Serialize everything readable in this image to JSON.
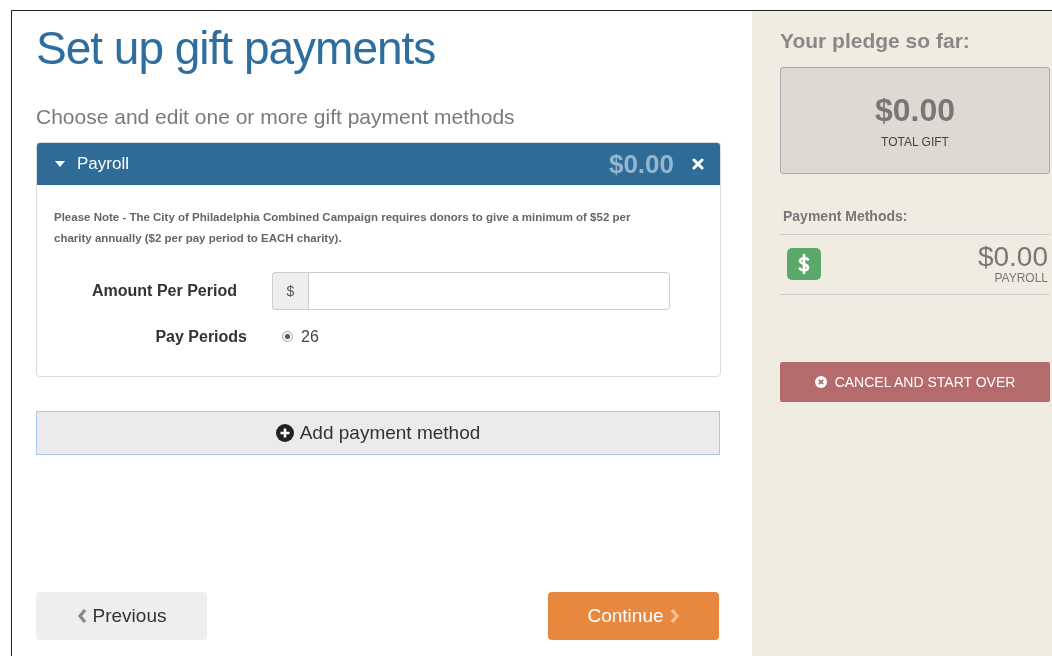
{
  "page": {
    "title": "Set up gift payments",
    "subtitle": "Choose and edit one or more gift payment methods"
  },
  "methods": [
    {
      "name": "Payroll",
      "amount": "$0.00",
      "expanded": true,
      "note": "Please Note - The City of Philadelphia Combined Campaign requires donors to give a minimum of $52 per charity annually ($2 per pay period to EACH charity).",
      "amount_label": "Amount Per Period",
      "amount_prefix": "$",
      "periods_label": "Pay Periods",
      "period_options": [
        {
          "label": "26",
          "selected": true
        }
      ]
    }
  ],
  "add_button": "Add payment method",
  "nav": {
    "previous": "Previous",
    "continue": "Continue"
  },
  "sidebar": {
    "heading": "Your pledge so far:",
    "total": "$0.00",
    "total_label": "TOTAL GIFT",
    "methods_heading": "Payment Methods:",
    "methods": [
      {
        "amount": "$0.00",
        "label": "PAYROLL"
      }
    ],
    "cancel_button": "CANCEL AND START OVER"
  }
}
